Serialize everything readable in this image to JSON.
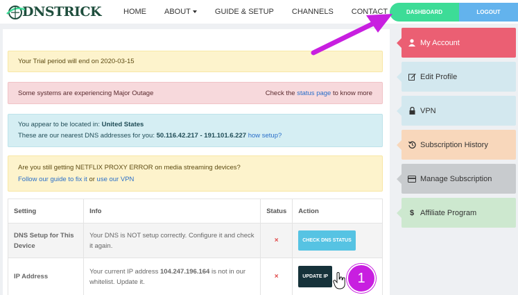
{
  "nav": {
    "logo_text": "DNSTRICK",
    "items": [
      "HOME",
      "ABOUT",
      "GUIDE & SETUP",
      "CHANNELS",
      "CONTACT"
    ],
    "dashboard_label": "DASHBOARD",
    "logout_label": "LOGOUT"
  },
  "alerts": {
    "trial": "Your Trial period will end on 2020-03-15",
    "outage": "Some systems are experiencing Major Outage",
    "outage_right_pre": "Check the",
    "outage_link": "status page",
    "outage_right_post": "to know more",
    "loc_pre": "You appear to be located in:",
    "loc_country": "United States",
    "dns_pre": "These are our nearest DNS addresses for you:",
    "dns_addrs": "50.116.42.217 - 191.101.6.227",
    "dns_link": "how setup?",
    "netflix": "Are you still getting NETFLIX PROXY ERROR on media streaming devices?",
    "netflix_link1": "Follow our guide to fix it",
    "netflix_or": "or",
    "netflix_link2": "use our VPN"
  },
  "table": {
    "headers": [
      "Setting",
      "Info",
      "Status",
      "Action"
    ],
    "rows": [
      {
        "setting": "DNS Setup for This Device",
        "info": "Your DNS is NOT setup correctly. Configure it and check it again.",
        "status": "×",
        "action": "CHECK DNS STATUS"
      },
      {
        "setting": "IP Address",
        "info_pre": "Your current IP address",
        "ip": "104.247.196.164",
        "info_post": "is not in our whitelist. Update it.",
        "status": "×",
        "action": "UPDATE IP"
      }
    ]
  },
  "sidebar": {
    "items": [
      {
        "label": "My Account",
        "icon": "user-icon"
      },
      {
        "label": "Edit Profile",
        "icon": "edit-icon"
      },
      {
        "label": "VPN",
        "icon": "lock-icon"
      },
      {
        "label": "Subscription History",
        "icon": "history-icon"
      },
      {
        "label": "Manage Subscription",
        "icon": "credit-card-icon"
      },
      {
        "label": "Affiliate Program",
        "icon": "dollar-icon"
      }
    ]
  },
  "annotation": {
    "step": "1",
    "accent": "#c81fe0"
  }
}
